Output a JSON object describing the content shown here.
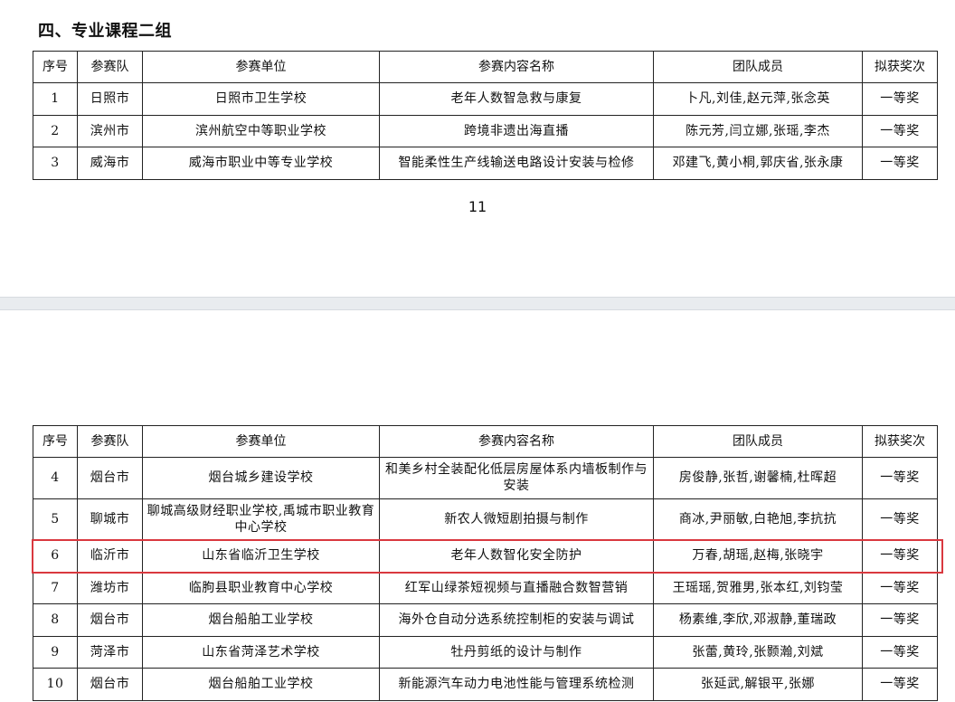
{
  "section_title": "四、专业课程二组",
  "page_number": "11",
  "headers": [
    "序号",
    "参赛队",
    "参赛单位",
    "参赛内容名称",
    "团队成员",
    "拟获奖次"
  ],
  "top_rows": [
    {
      "idx": "1",
      "team": "日照市",
      "unit": "日照市卫生学校",
      "content": "老年人数智急救与康复",
      "members": "卜凡,刘佳,赵元萍,张念英",
      "award": "一等奖"
    },
    {
      "idx": "2",
      "team": "滨州市",
      "unit": "滨州航空中等职业学校",
      "content": "跨境非遗出海直播",
      "members": "陈元芳,闫立娜,张瑶,李杰",
      "award": "一等奖"
    },
    {
      "idx": "3",
      "team": "威海市",
      "unit": "威海市职业中等专业学校",
      "content": "智能柔性生产线输送电路设计安装与检修",
      "members": "邓建飞,黄小桐,郭庆省,张永康",
      "award": "一等奖"
    }
  ],
  "bottom_rows": [
    {
      "idx": "4",
      "team": "烟台市",
      "unit": "烟台城乡建设学校",
      "content": "和美乡村全装配化低层房屋体系内墙板制作与安装",
      "members": "房俊静,张哲,谢馨楠,杜晖超",
      "award": "一等奖"
    },
    {
      "idx": "5",
      "team": "聊城市",
      "unit": "聊城高级财经职业学校,禹城市职业教育中心学校",
      "content": "新农人微短剧拍摄与制作",
      "members": "商冰,尹丽敏,白艳旭,李抗抗",
      "award": "一等奖"
    },
    {
      "idx": "6",
      "team": "临沂市",
      "unit": "山东省临沂卫生学校",
      "content": "老年人数智化安全防护",
      "members": "万春,胡瑶,赵梅,张晓宇",
      "award": "一等奖"
    },
    {
      "idx": "7",
      "team": "潍坊市",
      "unit": "临朐县职业教育中心学校",
      "content": "红军山绿茶短视频与直播融合数智营销",
      "members": "王瑶瑶,贺雅男,张本红,刘钧莹",
      "award": "一等奖"
    },
    {
      "idx": "8",
      "team": "烟台市",
      "unit": "烟台船舶工业学校",
      "content": "海外仓自动分选系统控制柜的安装与调试",
      "members": "杨素维,李欣,邓淑静,董瑞政",
      "award": "一等奖"
    },
    {
      "idx": "9",
      "team": "菏泽市",
      "unit": "山东省菏泽艺术学校",
      "content": "牡丹剪纸的设计与制作",
      "members": "张蕾,黄玲,张颢瀚,刘斌",
      "award": "一等奖"
    },
    {
      "idx": "10",
      "team": "烟台市",
      "unit": "烟台船舶工业学校",
      "content": "新能源汽车动力电池性能与管理系统检测",
      "members": "张延武,解银平,张娜",
      "award": "一等奖"
    }
  ],
  "highlight_color": "#d9383f"
}
